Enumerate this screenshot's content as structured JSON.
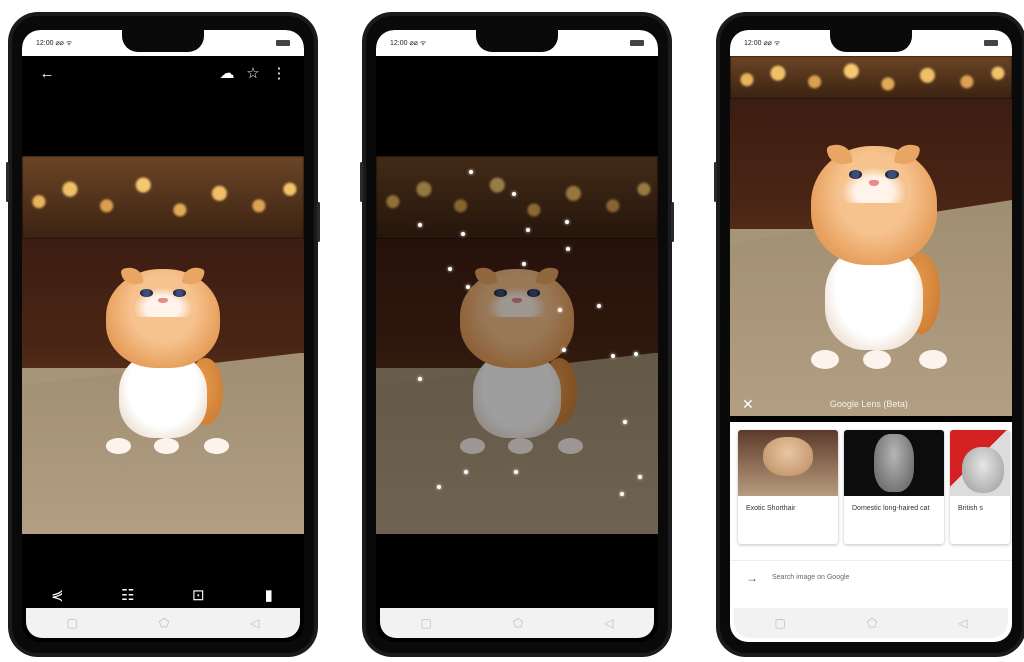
{
  "phones": [
    {
      "status_time": "12:00 ⌀⌀ ᯤ",
      "top_icons": [
        "back-arrow-icon",
        "cloud-upload-icon",
        "star-icon",
        "more-vert-icon"
      ],
      "bottom_icons": [
        "share-icon",
        "tune-icon",
        "lens-icon",
        "delete-icon"
      ],
      "nav_icons": [
        "recents-icon",
        "home-icon",
        "back-icon"
      ]
    },
    {
      "status_time": "12:00 ⌀⌀ ᯤ",
      "nav_icons": [
        "recents-icon",
        "home-icon",
        "back-icon"
      ]
    },
    {
      "status_time": "12:00 ⌀⌀ ᯤ",
      "lens_title": "Google Lens (Beta)",
      "results": [
        {
          "caption": "Exotic Shorthair"
        },
        {
          "caption": "Domestic long-haired cat"
        },
        {
          "caption": "British s"
        }
      ],
      "search_link": "Search image on Google",
      "nav_icons": [
        "recents-icon",
        "home-icon",
        "back-icon"
      ]
    }
  ]
}
